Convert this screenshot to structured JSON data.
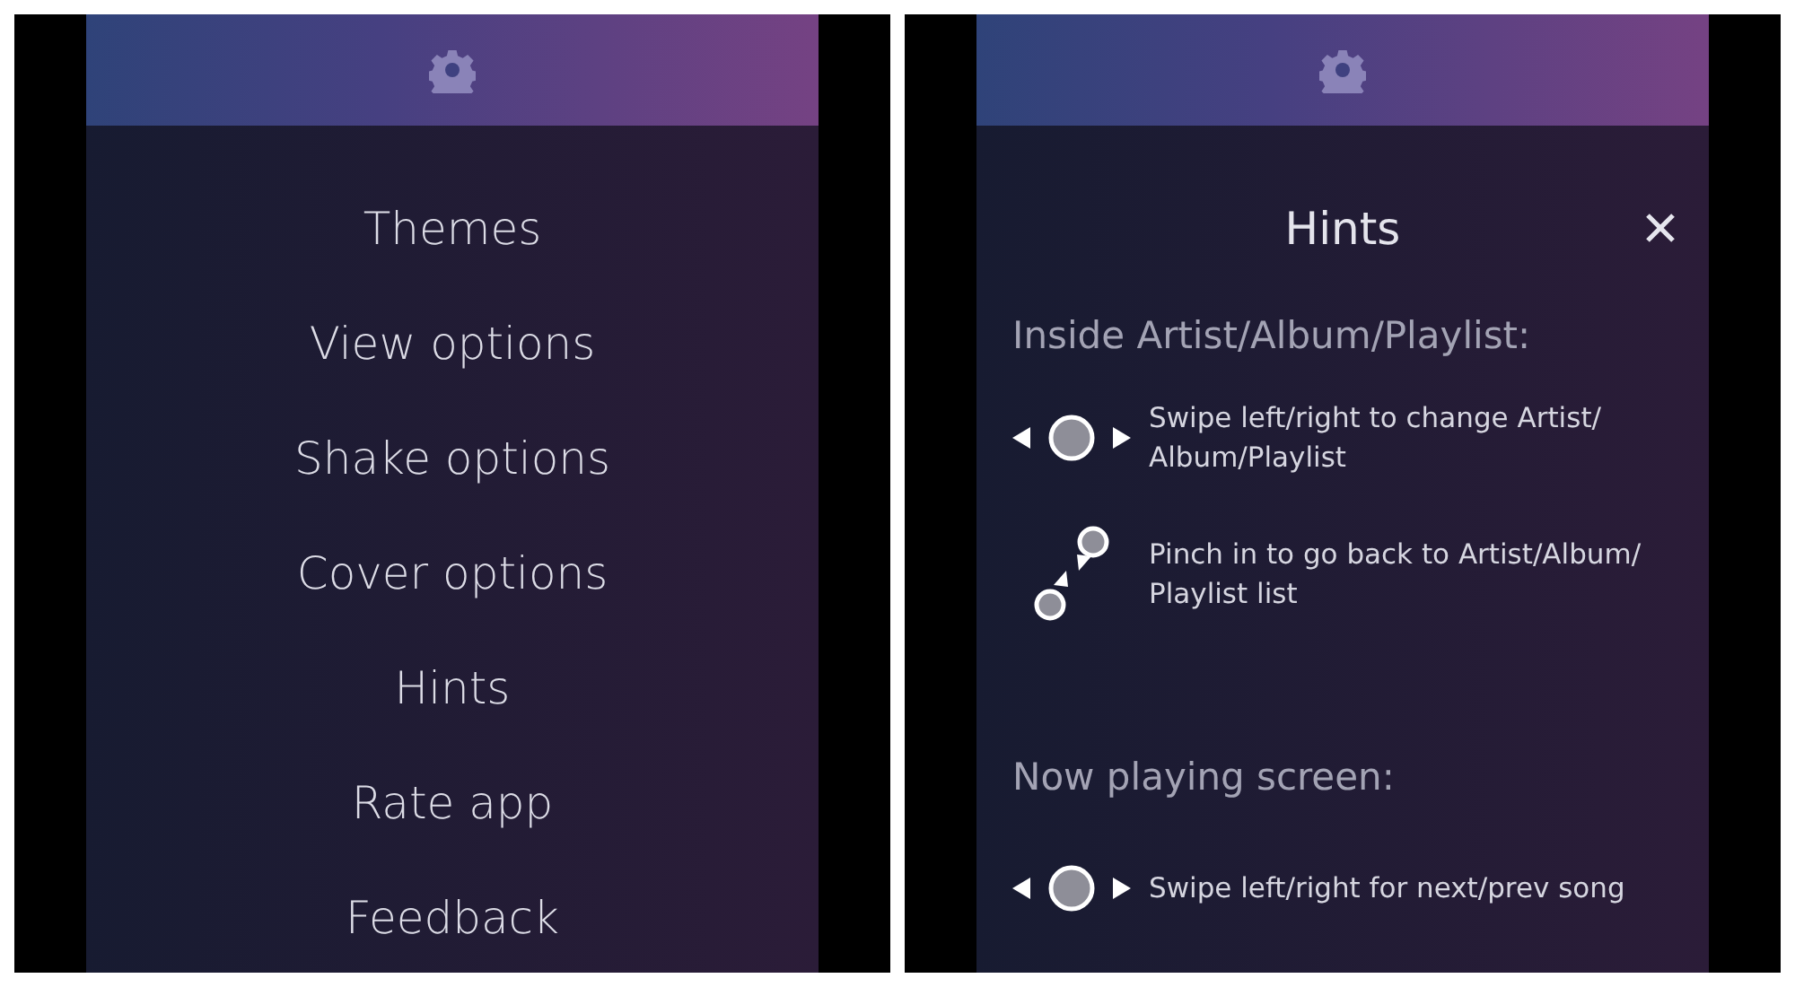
{
  "menu_screen": {
    "items": [
      {
        "label": "Themes"
      },
      {
        "label": "View options"
      },
      {
        "label": "Shake options"
      },
      {
        "label": "Cover options"
      },
      {
        "label": "Hints"
      },
      {
        "label": "Rate app"
      },
      {
        "label": "Feedback"
      }
    ]
  },
  "hints_screen": {
    "title": "Hints",
    "sections": [
      {
        "heading": "Inside Artist/Album/Playlist:",
        "hints": [
          {
            "kind": "swipe",
            "text": "Swipe left/right to change Artist/ Album/Playlist"
          },
          {
            "kind": "pinch",
            "text": "Pinch in to go back to Artist/Album/ Playlist list"
          }
        ]
      },
      {
        "heading": "Now playing screen:",
        "hints": [
          {
            "kind": "swipe",
            "text": "Swipe left/right for next/prev song"
          }
        ]
      }
    ]
  }
}
